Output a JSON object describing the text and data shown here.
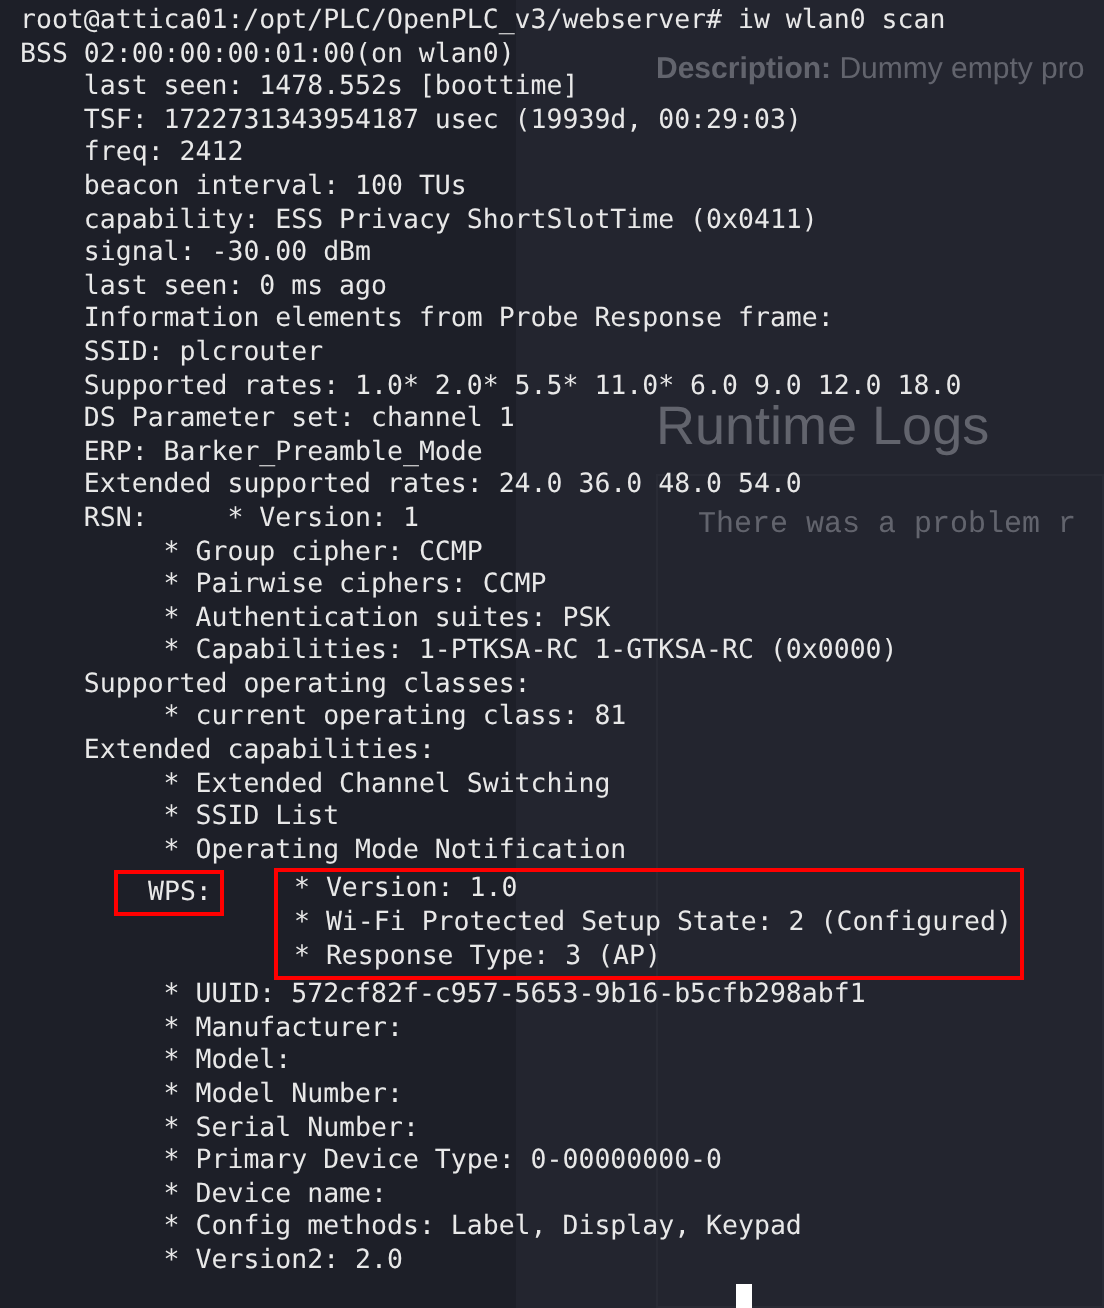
{
  "background_page": {
    "description_label": "Description:",
    "description": "Dummy empty pro",
    "section_title": "Runtime Logs",
    "log_text": "There was a problem r"
  },
  "terminal": {
    "command_line": "root@attica01:/opt/PLC/OpenPLC_v3/webserver# iw wlan0 scan",
    "lines": [
      "BSS 02:00:00:00:01:00(on wlan0)",
      "\tlast seen: 1478.552s [boottime]",
      "\tTSF: 1722731343954187 usec (19939d, 00:29:03)",
      "\tfreq: 2412",
      "\tbeacon interval: 100 TUs",
      "\tcapability: ESS Privacy ShortSlotTime (0x0411)",
      "\tsignal: -30.00 dBm",
      "\tlast seen: 0 ms ago",
      "\tInformation elements from Probe Response frame:",
      "\tSSID: plcrouter",
      "\tSupported rates: 1.0* 2.0* 5.5* 11.0* 6.0 9.0 12.0 18.0",
      "\tDS Parameter set: channel 1",
      "\tERP: Barker_Preamble_Mode",
      "\tExtended supported rates: 24.0 36.0 48.0 54.0",
      "\tRSN:\t * Version: 1",
      "\t\t * Group cipher: CCMP",
      "\t\t * Pairwise ciphers: CCMP",
      "\t\t * Authentication suites: PSK",
      "\t\t * Capabilities: 1-PTKSA-RC 1-GTKSA-RC (0x0000)",
      "\tSupported operating classes:",
      "\t\t * current operating class: 81",
      "\tExtended capabilities:",
      "\t\t * Extended Channel Switching",
      "\t\t * SSID List",
      "\t\t * Operating Mode Notification"
    ],
    "wps": {
      "label": "WPS:",
      "highlighted_lines": [
        "* Version: 1.0",
        "* Wi-Fi Protected Setup State: 2 (Configured)",
        "* Response Type: 3 (AP)"
      ],
      "lines": [
        "\t\t * UUID: 572cf82f-c957-5653-9b16-b5cfb298abf1",
        "\t\t * Manufacturer:",
        "\t\t * Model:",
        "\t\t * Model Number:",
        "\t\t * Serial Number:",
        "\t\t * Primary Device Type: 0-00000000-0",
        "\t\t * Device name:",
        "\t\t * Config methods: Label, Display, Keypad",
        "\t\t * Version2: 2.0"
      ]
    }
  }
}
